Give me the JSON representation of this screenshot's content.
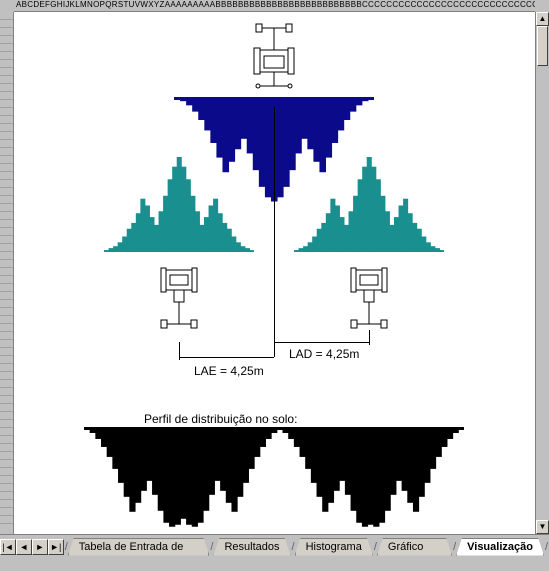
{
  "column_header": "ABCDEFGHIJKLMNOPQRSTUVWXYZAAAAAAAAABBBBBBBBBBBBBBBBBBBBBBBBBBCCCCCCCCCCCCCCCCCCCCCCCCCCCCCCCC",
  "labels": {
    "lae": "LAE = 4,25m",
    "lad": "LAD = 4,25m",
    "profile": "Perfil de distribuição no solo:"
  },
  "tabs": {
    "nav": {
      "first": "|◄",
      "prev": "◄",
      "next": "►",
      "last": "►|"
    },
    "items": [
      {
        "label": "Tabela de Entrada de dados",
        "active": false
      },
      {
        "label": "Resultados",
        "active": false
      },
      {
        "label": "Histograma",
        "active": false
      },
      {
        "label": "Gráfico (CV)",
        "active": false
      },
      {
        "label": "Visualização",
        "active": true
      }
    ]
  },
  "chart_data": {
    "type": "bar",
    "title": "Perfil de distribuição no solo",
    "series": [
      {
        "name": "left_tree",
        "color": "#1a8f8f",
        "values": [
          2,
          4,
          6,
          10,
          16,
          24,
          30,
          40,
          55,
          48,
          36,
          28,
          42,
          58,
          75,
          88,
          98,
          88,
          75,
          58,
          42,
          28,
          36,
          48,
          55,
          40,
          30,
          24,
          16,
          10,
          6,
          4,
          2
        ]
      },
      {
        "name": "center_tree_inverted",
        "color": "#0a0a8a",
        "values": [
          2,
          4,
          8,
          14,
          22,
          32,
          44,
          58,
          72,
          62,
          50,
          40,
          54,
          70,
          86,
          96,
          100,
          96,
          86,
          70,
          54,
          40,
          50,
          62,
          72,
          58,
          44,
          32,
          22,
          14,
          8,
          4,
          2
        ]
      },
      {
        "name": "right_tree",
        "color": "#1a8f8f",
        "values": [
          2,
          4,
          6,
          10,
          16,
          24,
          30,
          40,
          55,
          48,
          36,
          28,
          42,
          58,
          75,
          88,
          98,
          88,
          75,
          58,
          42,
          28,
          36,
          48,
          55,
          40,
          30,
          24,
          16,
          10,
          6,
          4,
          2
        ]
      },
      {
        "name": "combined_profile",
        "color": "#000000",
        "values": [
          2,
          6,
          12,
          20,
          30,
          42,
          56,
          70,
          85,
          76,
          64,
          54,
          68,
          84,
          96,
          100,
          98,
          92,
          98,
          100,
          96,
          84,
          68,
          54,
          64,
          76,
          85,
          70,
          56,
          42,
          30,
          20,
          12,
          6,
          2,
          6,
          12,
          20,
          30,
          42,
          56,
          70,
          85,
          76,
          64,
          54,
          68,
          84,
          96,
          100,
          98,
          100,
          96,
          84,
          68,
          54,
          64,
          76,
          85,
          70,
          56,
          42,
          30,
          20,
          12,
          6,
          2
        ]
      }
    ],
    "lae_m": 4.25,
    "lad_m": 4.25
  }
}
